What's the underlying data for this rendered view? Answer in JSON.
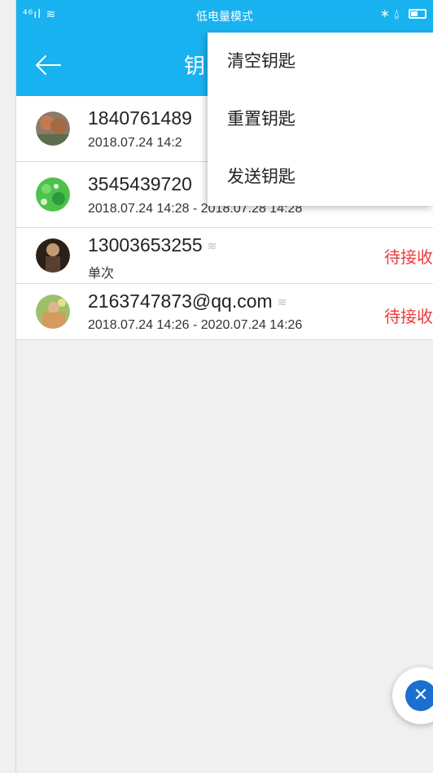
{
  "status_bar": {
    "signal": "⁴⁶ıl ≋",
    "mode": "低电量模式",
    "right_icons": "∗ ⍙"
  },
  "app_bar": {
    "title": "钥"
  },
  "keys": [
    {
      "account": "1840761489",
      "sub": "2018.07.24 14:2",
      "status": ""
    },
    {
      "account": "3545439720",
      "sub": "2018.07.24 14:28 - 2018.07.28 14:28",
      "status": ""
    },
    {
      "account": "13003653255",
      "sub": "单次",
      "status": "待接收"
    },
    {
      "account": "2163747873@qq.com",
      "sub": "2018.07.24 14:26 - 2020.07.24 14:26",
      "status": "待接收"
    }
  ],
  "menu": {
    "items": [
      "清空钥匙",
      "重置钥匙",
      "发送钥匙"
    ]
  },
  "colors": {
    "accent": "#19b2f0",
    "status_red": "#ee3a3a"
  }
}
